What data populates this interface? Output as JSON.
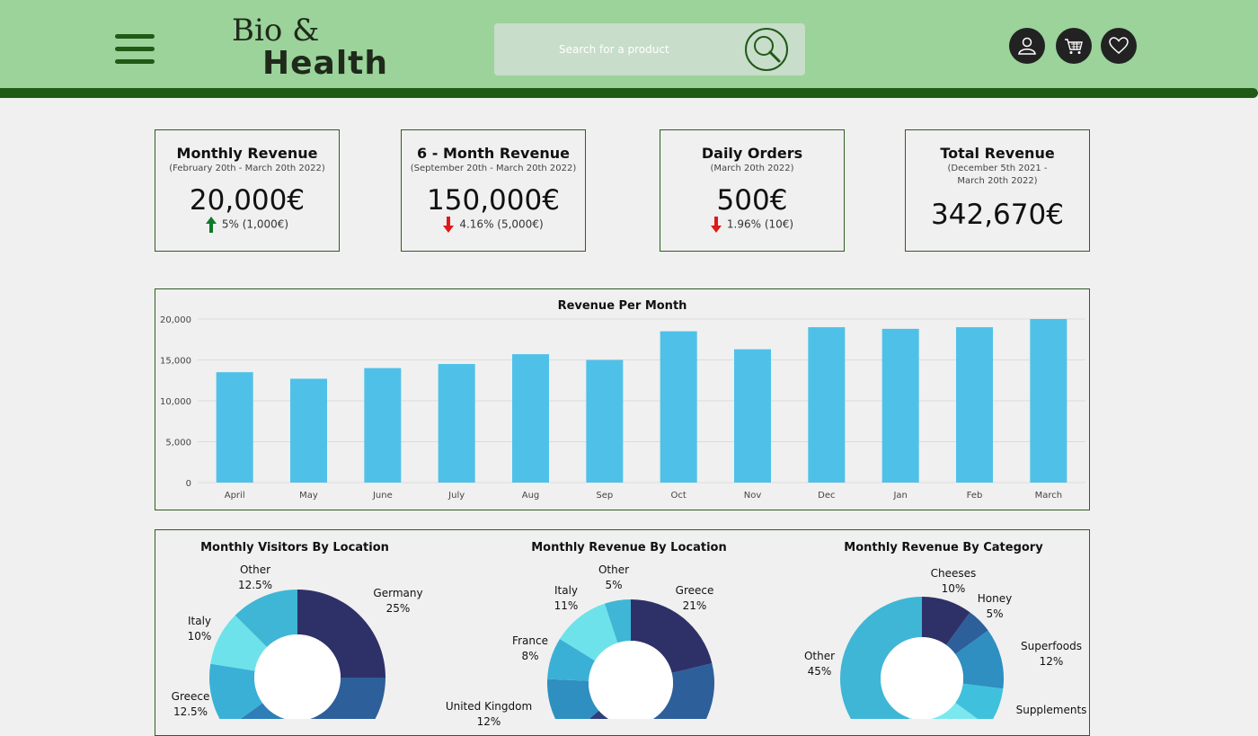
{
  "header": {
    "logo_line1": "Bio &",
    "logo_line2": "Health",
    "search_placeholder": "Search for a product",
    "colors": {
      "header_bg": "#9bd39a",
      "accent_dark": "#1f5a16"
    },
    "icons": [
      "menu-icon",
      "search-icon",
      "user-icon",
      "cart-icon",
      "heart-icon"
    ]
  },
  "kpis": [
    {
      "title": "Monthly Revenue",
      "subtitle": "(February 20th - March 20th 2022)",
      "value": "20,000€",
      "change": "5% (1,000€)",
      "direction": "up"
    },
    {
      "title": "6 - Month Revenue",
      "subtitle": "(September 20th - March 20th 2022)",
      "value": "150,000€",
      "change": "4.16% (5,000€)",
      "direction": "down"
    },
    {
      "title": "Daily Orders",
      "subtitle": "(March 20th 2022)",
      "value": "500€",
      "change": "1.96% (10€)",
      "direction": "down"
    },
    {
      "title": "Total Revenue",
      "subtitle": "(December 5th 2021 - March 20th 2022)",
      "value": "342,670€",
      "change": "",
      "direction": "none"
    }
  ],
  "chart_data": [
    {
      "type": "bar",
      "title": "Revenue Per Month",
      "categories": [
        "April",
        "May",
        "June",
        "July",
        "Aug",
        "Sep",
        "Oct",
        "Nov",
        "Dec",
        "Jan",
        "Feb",
        "March"
      ],
      "values": [
        13500,
        12700,
        14000,
        14500,
        15700,
        15000,
        18500,
        16300,
        19000,
        18800,
        19000,
        20000
      ],
      "ylim": [
        0,
        20000
      ],
      "yticks": [
        "0",
        "5,000",
        "10,000",
        "15,000",
        "20,000"
      ],
      "grid": true,
      "color": "#4fc1e8"
    },
    {
      "type": "pie",
      "title": "Monthly Visitors By Location",
      "slices": [
        {
          "label": "Germany",
          "pct": "25%",
          "value": 25,
          "color": "#2e3168"
        },
        {
          "label": "",
          "pct": "",
          "value": 25,
          "color": "#2d5f9a"
        },
        {
          "label": "",
          "pct": "",
          "value": 15,
          "color": "#2e7fb8"
        },
        {
          "label": "Greece",
          "pct": "12.5%",
          "value": 12.5,
          "color": "#3ab0d6"
        },
        {
          "label": "Italy",
          "pct": "10%",
          "value": 10,
          "color": "#6ee2ea"
        },
        {
          "label": "Other",
          "pct": "12.5%",
          "value": 12.5,
          "color": "#3fb6d6"
        }
      ]
    },
    {
      "type": "pie",
      "title": "Monthly Revenue By Location",
      "slices": [
        {
          "label": "Greece",
          "pct": "21%",
          "value": 21,
          "color": "#2e3168"
        },
        {
          "label": "",
          "pct": "",
          "value": 20,
          "color": "#2d5f9a"
        },
        {
          "label": "",
          "pct": "",
          "value": 22,
          "color": "#2e3f7a"
        },
        {
          "label": "United Kingdom",
          "pct": "12%",
          "value": 12,
          "color": "#2e8fc0"
        },
        {
          "label": "France",
          "pct": "8%",
          "value": 8,
          "color": "#3ab0d6"
        },
        {
          "label": "Italy",
          "pct": "11%",
          "value": 11,
          "color": "#6ee2ea"
        },
        {
          "label": "Other",
          "pct": "5%",
          "value": 5,
          "color": "#3fb6d6"
        }
      ]
    },
    {
      "type": "pie",
      "title": "Monthly Revenue By Category",
      "slices": [
        {
          "label": "Cheeses",
          "pct": "10%",
          "value": 10,
          "color": "#2e3168"
        },
        {
          "label": "Honey",
          "pct": "5%",
          "value": 5,
          "color": "#2d5f9a"
        },
        {
          "label": "Superfoods",
          "pct": "12%",
          "value": 12,
          "color": "#2e8fc0"
        },
        {
          "label": "Supplements",
          "pct": "",
          "value": 8,
          "color": "#3fc1dd"
        },
        {
          "label": "",
          "pct": "",
          "value": 20,
          "color": "#7ae8ee"
        },
        {
          "label": "Other",
          "pct": "45%",
          "value": 45,
          "color": "#3fb6d6"
        }
      ]
    }
  ]
}
